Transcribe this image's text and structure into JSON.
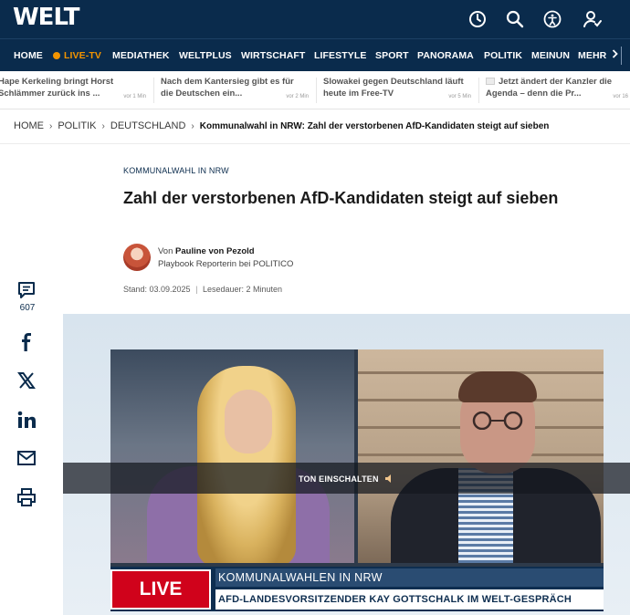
{
  "header": {
    "logo": "WELT",
    "icons": [
      "clock-icon",
      "search-icon",
      "accessibility-icon",
      "account-icon"
    ]
  },
  "nav": {
    "items": [
      {
        "label": "HOME"
      },
      {
        "label": "LIVE-TV",
        "live": true
      },
      {
        "label": "MEDIATHEK"
      },
      {
        "label": "WELTPLUS"
      },
      {
        "label": "WIRTSCHAFT"
      },
      {
        "label": "LIFESTYLE"
      },
      {
        "label": "SPORT"
      },
      {
        "label": "PANORAMA"
      },
      {
        "label": "POLITIK"
      },
      {
        "label": "MEINUN"
      },
      {
        "label": "MEHR"
      }
    ],
    "accent": "#f29400"
  },
  "ticker": [
    {
      "line1": "Hape Kerkeling bringt Horst",
      "line2": "Schlämmer zurück ins ...",
      "time": "vor 1 Min"
    },
    {
      "line1": "Nach dem Kantersieg gibt es für",
      "line2": "die Deutschen ein...",
      "time": "vor 2 Min"
    },
    {
      "line1": "Slowakei gegen Deutschland läuft",
      "line2": "heute im Free-TV",
      "time": "vor 5 Min"
    },
    {
      "line1": "Jetzt ändert der Kanzler die",
      "line2": "Agenda – denn die Pr...",
      "time": "vor 16"
    }
  ],
  "breadcrumb": {
    "items": [
      "HOME",
      "POLITIK",
      "DEUTSCHLAND"
    ],
    "current": "Kommunalwahl in NRW: Zahl der verstorbenen AfD-Kandidaten steigt auf sieben"
  },
  "article": {
    "kicker": "KOMMUNALWAHL IN NRW",
    "headline": "Zahl der verstorbenen AfD-Kandidaten steigt auf sieben",
    "author_prefix": "Von",
    "author_name": "Pauline von Pezold",
    "author_role": "Playbook Reporterin bei POLITICO",
    "stand": "Stand: 03.09.2025",
    "read_time": "Lesedauer: 2 Minuten"
  },
  "share": {
    "comment_count": "607",
    "icons": [
      "comment-icon",
      "facebook-icon",
      "x-icon",
      "linkedin-icon",
      "mail-icon",
      "print-icon"
    ]
  },
  "video": {
    "sound_label": "TON EINSCHALTEN",
    "live_label": "LIVE",
    "lower_top": "KOMMUNALWAHLEN IN NRW",
    "lower_bottom": "AFD-LANDESVORSITZENDER KAY GOTTSCHALK IM WELT-GESPRÄCH"
  }
}
